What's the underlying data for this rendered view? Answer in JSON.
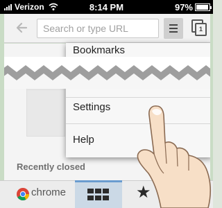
{
  "status_bar": {
    "carrier": "Verizon",
    "time": "8:14 PM",
    "battery": "97%",
    "battery_level": 0.97
  },
  "toolbar": {
    "omnibox_placeholder": "Search or type URL",
    "tab_count": "1"
  },
  "menu": {
    "items": [
      "Bookmarks",
      "Settings",
      "Help"
    ]
  },
  "content": {
    "recently_closed_label": "Recently closed"
  },
  "bottom_bar": {
    "chrome_label": "chrome"
  },
  "colors": {
    "accent": "#6a9ccf",
    "selected_tab_bg": "#cbd9e6",
    "menu_bg": "#f7f7f7"
  }
}
